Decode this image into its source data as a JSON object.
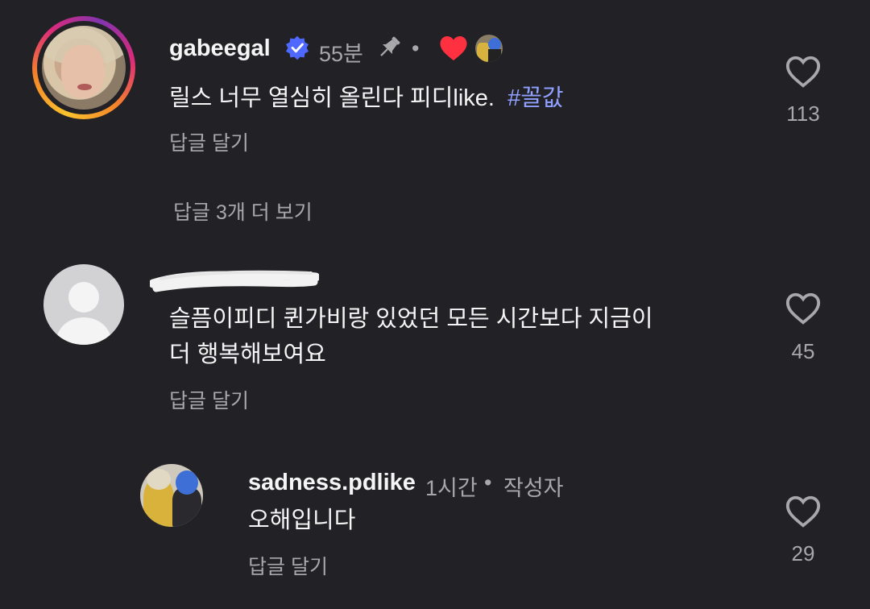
{
  "comments": [
    {
      "username": "gabeegal",
      "verified": true,
      "time": "55분",
      "pinned_icon": "pin-icon",
      "separator": "•",
      "liked_by_author": true,
      "text": "릴스 너무 열심히 올린다 피디like.",
      "hashtag": "#꼴값",
      "reply_label": "답글 달기",
      "like_count": "113"
    },
    {
      "username": "",
      "time": "",
      "text_line1": "슬픔이피디 퀸가비랑 있었던 모든 시간보다 지금이",
      "text_line2": "더 행복해보여요",
      "reply_label": "답글 달기",
      "like_count": "45"
    },
    {
      "username": "sadness.pdlike",
      "time": "1시간",
      "separator": "•",
      "author_badge": "작성자",
      "text": "오해입니다",
      "reply_label": "답글 달기",
      "like_count": "29"
    }
  ],
  "view_replies_label": "답글 3개 더 보기",
  "colors": {
    "background": "#222226",
    "verified_blue": "#4f68ff",
    "heart_red": "#ff3040",
    "hashtag": "#8fa0ff",
    "muted_text": "#a8a8ab"
  }
}
